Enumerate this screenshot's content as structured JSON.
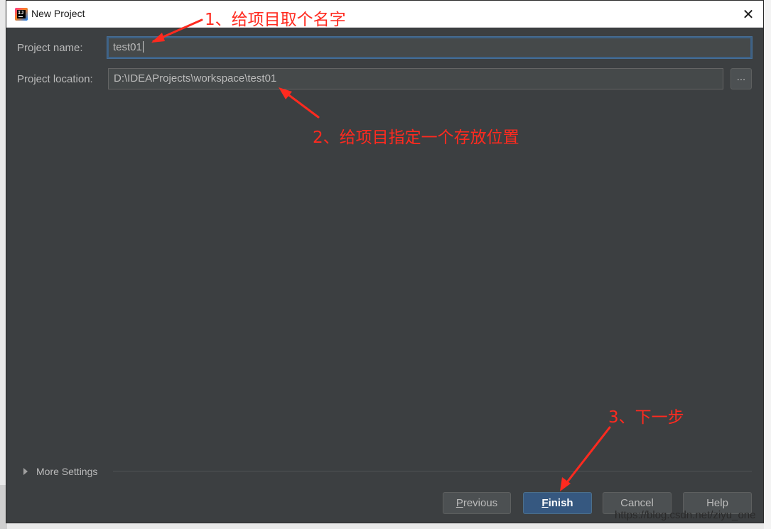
{
  "window": {
    "title": "New Project",
    "close_glyph": "✕",
    "app_icon": "intellij-idea-icon",
    "app_icon_text": "IJ"
  },
  "form": {
    "project_name_label": "Project name:",
    "project_name_value": "test01",
    "project_location_label": "Project location:",
    "project_location_value": "D:\\IDEAProjects\\workspace\\test01",
    "browse_label": "..."
  },
  "more_settings": {
    "label": "More Settings",
    "expanded": false
  },
  "buttons": {
    "previous": {
      "mnemonic": "P",
      "rest": "revious"
    },
    "finish": {
      "mnemonic": "F",
      "rest": "inish"
    },
    "cancel": "Cancel",
    "help": "Help"
  },
  "annotations": {
    "step1": "1、给项目取个名字",
    "step2": "2、给项目指定一个存放位置",
    "step3": "3、下一步",
    "color": "#ff2a1f"
  },
  "watermark": "https://blog.csdn.net/ziyu_one",
  "colors": {
    "dialog_bg": "#3c3f41",
    "field_bg": "#45494a",
    "focus_border": "#3d6185",
    "primary_button": "#365880",
    "text": "#bbbbbb"
  }
}
